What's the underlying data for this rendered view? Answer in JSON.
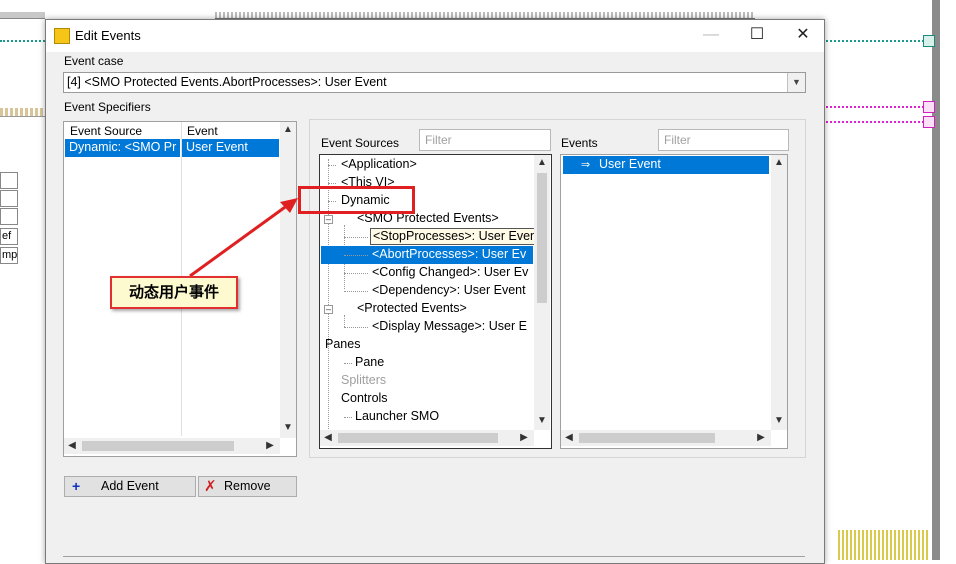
{
  "dialog": {
    "title": "Edit Events",
    "minimize_glyph": "—",
    "maximize_glyph": "☐",
    "close_glyph": "✕"
  },
  "event_case": {
    "label": "Event case",
    "value": "[4] <SMO Protected Events.AbortProcesses>: User Event"
  },
  "specifiers": {
    "label": "Event Specifiers",
    "col_source": "Event Source",
    "col_event": "Event",
    "row_source": "Dynamic: <SMO Pr",
    "row_event": "User Event"
  },
  "event_sources": {
    "label": "Event Sources",
    "filter_placeholder": "Filter",
    "items": [
      "<Application>",
      "<This VI>",
      "Dynamic",
      "<SMO Protected Events>",
      "<StopProcesses>: User Event",
      "<AbortProcesses>: User Ev",
      "<Config Changed>: User Ev",
      "<Dependency>: User Event",
      "<Protected Events>",
      "<Display Message>: User E",
      "Panes",
      "Pane",
      "Splitters",
      "Controls",
      "Launcher SMO"
    ]
  },
  "events": {
    "label": "Events",
    "filter_placeholder": "Filter",
    "items": [
      "User Event"
    ]
  },
  "buttons": {
    "add_event": "Add Event",
    "remove": "Remove"
  },
  "annotation": {
    "callout_text": "动态用户事件"
  },
  "background": {
    "cells": [
      "",
      "",
      "",
      "ef",
      "mp"
    ]
  },
  "colors": {
    "selection": "#0078d7",
    "annotation_red": "#e02020",
    "callout_fill": "#fdfad0"
  }
}
